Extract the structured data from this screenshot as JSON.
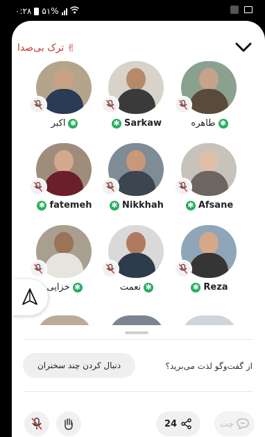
{
  "status_bar": {
    "time": "۰:۲۸",
    "battery": "۵۱%"
  },
  "header": {
    "mute_label": "ترک بی‌صدا"
  },
  "speakers": [
    {
      "name": "اکبر",
      "rtl": true
    },
    {
      "name": "Sarkaw",
      "rtl": false
    },
    {
      "name": "طاهره",
      "rtl": true
    },
    {
      "name": "fatemeh",
      "rtl": false
    },
    {
      "name": "Nikkhah",
      "rtl": false
    },
    {
      "name": "Afsane",
      "rtl": false
    },
    {
      "name": "خزایی",
      "rtl": true
    },
    {
      "name": "نعمت",
      "rtl": true
    },
    {
      "name": "Reza",
      "rtl": false
    }
  ],
  "footer": {
    "prompt": "از گفت‌وگو لذت می‌برید؟",
    "follow_button": "دنبال کردن چند سخنران",
    "share_count": "24",
    "chat_label": "چت"
  },
  "colors": {
    "mute_text": "#c0392b",
    "moderator_badge": "#27ae60"
  }
}
